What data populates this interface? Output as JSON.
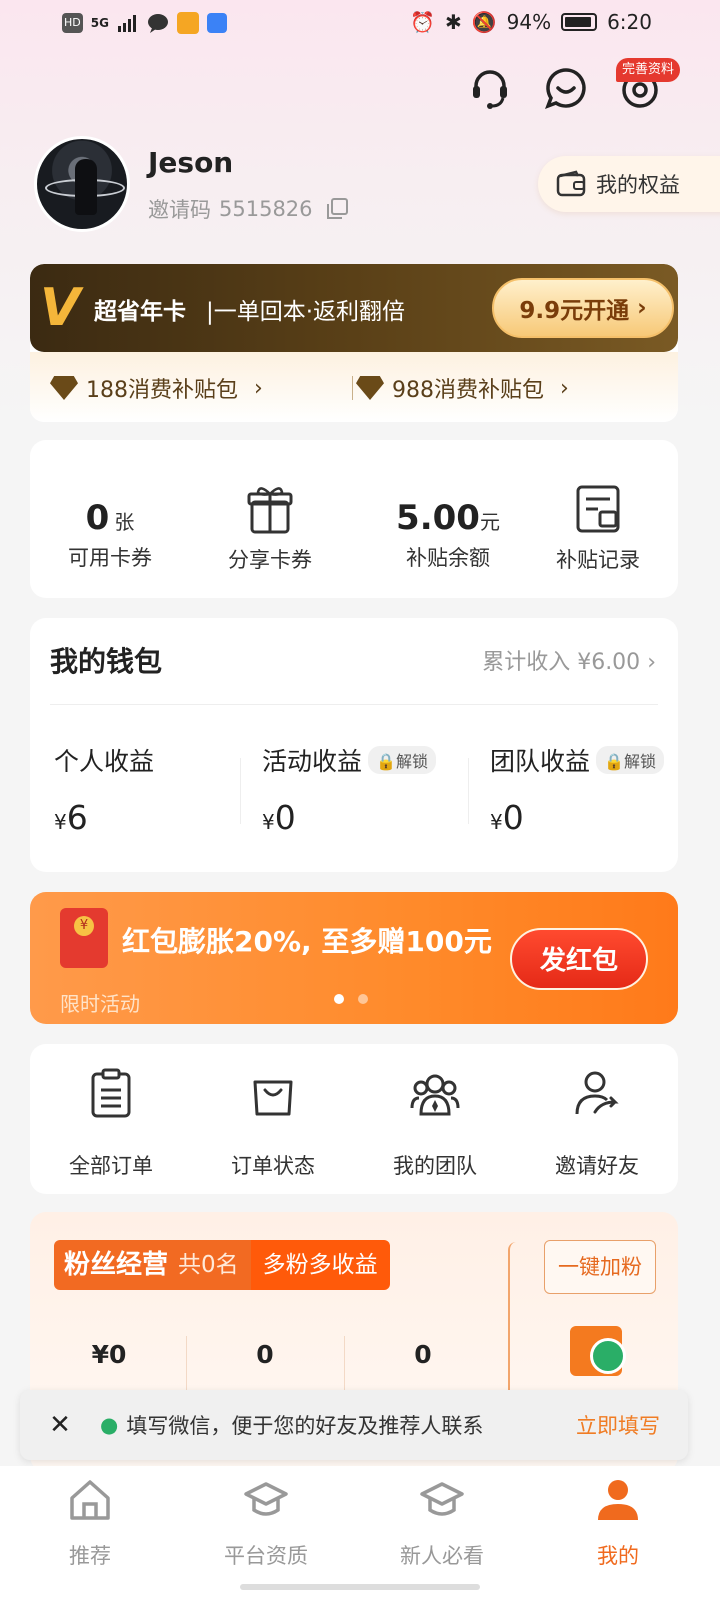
{
  "status_bar": {
    "left_chips": [
      "HD",
      "5G"
    ],
    "battery": "94%",
    "time": "6:20"
  },
  "header": {
    "badge": "完善资料"
  },
  "profile": {
    "name": "Jeson",
    "invite_label": "邀请码",
    "invite_code": "5515826",
    "rights_button": "我的权益"
  },
  "vip": {
    "logo": "V",
    "title": "超省年卡",
    "slogan": "|一单回本·返利翻倍",
    "open_button": "9.9元开通",
    "packages": [
      "188消费补贴包",
      "988消费补贴包"
    ]
  },
  "stats": [
    {
      "value": "0",
      "unit": "张",
      "label": "可用卡券"
    },
    {
      "label": "分享卡券"
    },
    {
      "value": "5.00",
      "unit": "元",
      "label": "补贴余额"
    },
    {
      "label": "补贴记录"
    }
  ],
  "wallet": {
    "title": "我的钱包",
    "total": "累计收入 ¥6.00",
    "items": [
      {
        "label": "个人收益",
        "currency": "¥",
        "value": "6"
      },
      {
        "label": "活动收益",
        "lock": "解锁",
        "currency": "¥",
        "value": "0"
      },
      {
        "label": "团队收益",
        "lock": "解锁",
        "currency": "¥",
        "value": "0"
      }
    ]
  },
  "promo": {
    "text": "红包膨胀20%, 至多赠100元",
    "sub": "限时活动",
    "button": "发红包"
  },
  "orders": [
    {
      "label": "全部订单",
      "icon": "clipboard-icon"
    },
    {
      "label": "订单状态",
      "icon": "bag-icon"
    },
    {
      "label": "我的团队",
      "icon": "team-icon"
    },
    {
      "label": "邀请好友",
      "icon": "invite-icon"
    }
  ],
  "fans": {
    "title": "粉丝经营",
    "count": "共0名",
    "slogan": "多粉多收益",
    "button": "一键加粉",
    "stats": [
      "¥0",
      "0",
      "0"
    ]
  },
  "notice": {
    "close": "✕",
    "text": "填写微信，便于您的好友及推荐人联系",
    "action": "立即填写"
  },
  "tabs": [
    {
      "label": "推荐"
    },
    {
      "label": "平台资质"
    },
    {
      "label": "新人必看"
    },
    {
      "label": "我的"
    }
  ],
  "colors": {
    "accent": "#f06a1e",
    "gold": "#f4b63a",
    "promo": "#ff8a2a"
  }
}
